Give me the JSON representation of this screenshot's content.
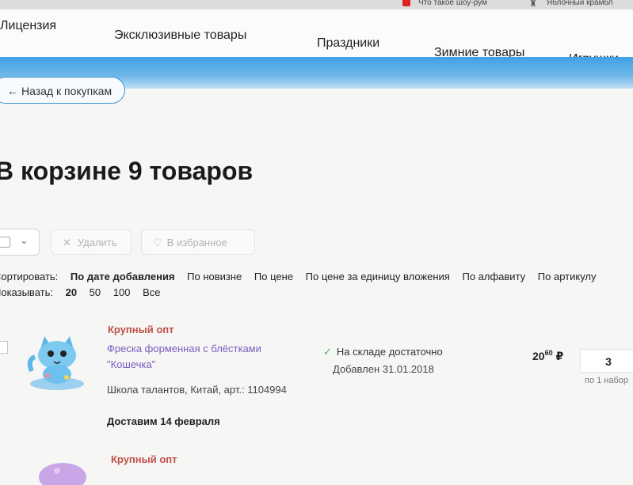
{
  "browser_tabs": [
    {
      "label": "Что такое шоу-рум"
    },
    {
      "label": "Яблочный крамбл"
    }
  ],
  "nav": {
    "items": [
      "Лицензия",
      "Эксклюзивные товары",
      "Праздники",
      "Зимние товары",
      "Игрушки"
    ]
  },
  "back_button": {
    "label": "Назад к покупкам"
  },
  "cart": {
    "title": "В корзине 9 товаров"
  },
  "toolbar": {
    "delete_label": "Удалить",
    "favorite_label": "В избранное"
  },
  "sort": {
    "label": "Сортировать:",
    "options": [
      "По дате добавления",
      "По новизне",
      "По цене",
      "По цене за единицу вложения",
      "По алфавиту",
      "По артикулу"
    ]
  },
  "show": {
    "label": "Показывать:",
    "options": [
      "20",
      "50",
      "100",
      "Все"
    ]
  },
  "products": [
    {
      "tag": "Крупный опт",
      "name": "Фреска форменная с блёстками \"Кошечка\"",
      "meta": "Школа талантов, Китай, арт.: 1104994",
      "delivery": "Доставим 14 февраля",
      "stock": "На складе достаточно",
      "added": "Добавлен 31.01.2018",
      "price_main": "20",
      "price_cents": "60",
      "currency": "₽",
      "quantity": "3",
      "unit": "по 1 набор"
    },
    {
      "tag": "Крупный опт"
    }
  ],
  "colors": {
    "accent_blue": "#3fa0e6",
    "tag_red": "#c0504a",
    "link_purple": "#7a5cc0",
    "stock_green": "#4caf50"
  }
}
